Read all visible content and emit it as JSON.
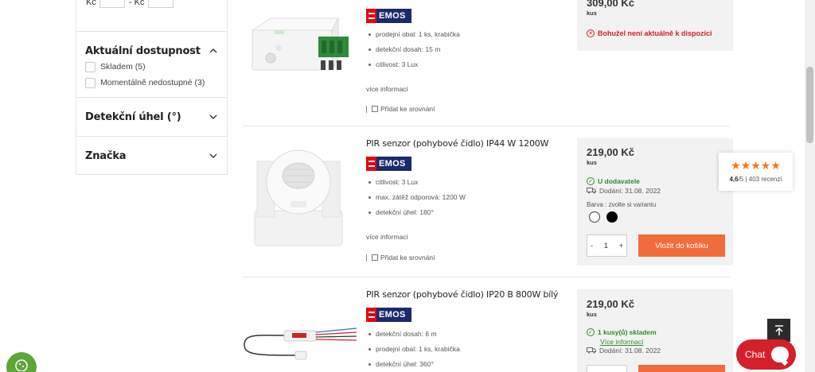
{
  "sidebar": {
    "price_filter": {
      "from_label": "Kč",
      "separator": "- Kč"
    },
    "availability": {
      "title": "Aktuální dostupnost",
      "options": [
        {
          "label": "Skladem (5)"
        },
        {
          "label": "Momentálně nedostupné (3)"
        }
      ]
    },
    "angle": {
      "title": "Detekční úhel (°)"
    },
    "brand": {
      "title": "Značka"
    }
  },
  "products": [
    {
      "brand_name": "EMOS",
      "features": [
        "prodejní obal: 1 ks, krabička",
        "detekční dosah: 15 m",
        "citlivost: 3 Lux"
      ],
      "more_info": "více informací",
      "compare_label": "Přidat ke srovnání",
      "price": "309,00 Kč",
      "unit": "kus",
      "availability": "Bohužel není aktuálně k dispozici"
    },
    {
      "name": "PIR senzor (pohybové čidlo) IP44 W 1200W",
      "brand_name": "EMOS",
      "features": [
        "citlivost: 3 Lux",
        "max. zátěž odporová: 1200 W",
        "detekční úhel: 180°"
      ],
      "more_info": "více informací",
      "compare_label": "Přidat ke srovnání",
      "price": "219,00 Kč",
      "unit": "kus",
      "availability": "U dodavatele",
      "delivery": "Dodání: 31.08. 2022",
      "variant_label": "Barva : zvolte si variantu",
      "qty": {
        "minus": "-",
        "value": "1",
        "plus": "+"
      },
      "add_to_cart": "Vložit do košíku"
    },
    {
      "name": "PIR senzor (pohybové čidlo) IP20 B 800W bílý",
      "brand_name": "EMOS",
      "features": [
        "detekční dosah: 6 m",
        "prodejní obal: 1 ks, krabička",
        "detekční úhel: 360°"
      ],
      "price": "219,00 Kč",
      "unit": "kus",
      "availability": "1 kusy(ů) skladem",
      "more_link": "Více informací",
      "delivery": "Dodání: 31.08. 2022"
    }
  ],
  "rating_widget": {
    "stars": "★★★★★",
    "score": "4,6",
    "rest": "/5 | 403 recenzí"
  },
  "chat": {
    "label": "Chat"
  },
  "colors": {
    "accent": "#f26b3a",
    "emos_blue": "#1b2a6b",
    "emos_red": "#e30613",
    "chat_red": "#d32029",
    "in_stock": "#2e8b2e"
  }
}
